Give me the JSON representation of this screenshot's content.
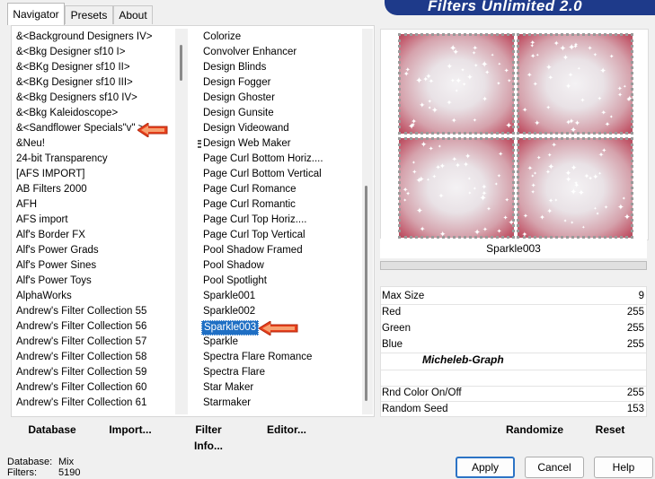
{
  "tabs": [
    "Navigator",
    "Presets",
    "About"
  ],
  "banner_title": "Filters Unlimited 2.0",
  "categories": [
    "&<Background Designers IV>",
    "&<Bkg Designer sf10 I>",
    "&<BKg Designer sf10 II>",
    "&<BKg Designer sf10 III>",
    "&<Bkg Designers sf10 IV>",
    "&<Bkg Kaleidoscope>",
    "&<Sandflower Specials\"v\" >",
    "&Neu!",
    "24-bit Transparency",
    "[AFS IMPORT]",
    "AB Filters 2000",
    "AFH",
    "AFS import",
    "Alf's Border FX",
    "Alf's Power Grads",
    "Alf's Power Sines",
    "Alf's Power Toys",
    "AlphaWorks",
    "Andrew's Filter Collection 55",
    "Andrew's Filter Collection 56",
    "Andrew's Filter Collection 57",
    "Andrew's Filter Collection 58",
    "Andrew's Filter Collection 59",
    "Andrew's Filter Collection 60",
    "Andrew's Filter Collection 61"
  ],
  "filters": [
    "Colorize",
    "Convolver Enhancer",
    "Design Blinds",
    "Design Fogger",
    "Design Ghoster",
    "Design Gunsite",
    "Design Videowand",
    "Design Web Maker",
    "Page Curl Bottom Horiz....",
    "Page Curl Bottom Vertical",
    "Page Curl Romance",
    "Page Curl Romantic",
    "Page Curl Top Horiz....",
    "Page Curl Top Vertical",
    "Pool Shadow Framed",
    "Pool Shadow",
    "Pool Spotlight",
    "Sparkle001",
    "Sparkle002",
    "Sparkle003",
    "Sparkle",
    "Spectra Flare Romance",
    "Spectra Flare",
    "Star Maker",
    "Starmaker"
  ],
  "selected_filter": "Sparkle003",
  "preset_name": "Sparkle003",
  "params": [
    {
      "label": "Max Size",
      "value": "9"
    },
    {
      "label": "Red",
      "value": "255"
    },
    {
      "label": "Green",
      "value": "255"
    },
    {
      "label": "Blue",
      "value": "255"
    },
    {
      "label": "Rnd Color On/Off",
      "value": "255"
    },
    {
      "label": "Random Seed",
      "value": "153"
    }
  ],
  "credit": "Micheleb-Graph",
  "toolbar": {
    "database": "Database",
    "import": "Import...",
    "filter_info": "Filter Info...",
    "editor": "Editor...",
    "randomize": "Randomize",
    "reset": "Reset"
  },
  "info": {
    "database_label": "Database:",
    "database_value": "Mix",
    "filters_label": "Filters:",
    "filters_value": "5190"
  },
  "dialog": {
    "apply": "Apply",
    "cancel": "Cancel",
    "help": "Help"
  },
  "colors": {
    "selection": "#1f6fc4",
    "banner": "#1e3a8a",
    "arrow": "#e8401c"
  }
}
